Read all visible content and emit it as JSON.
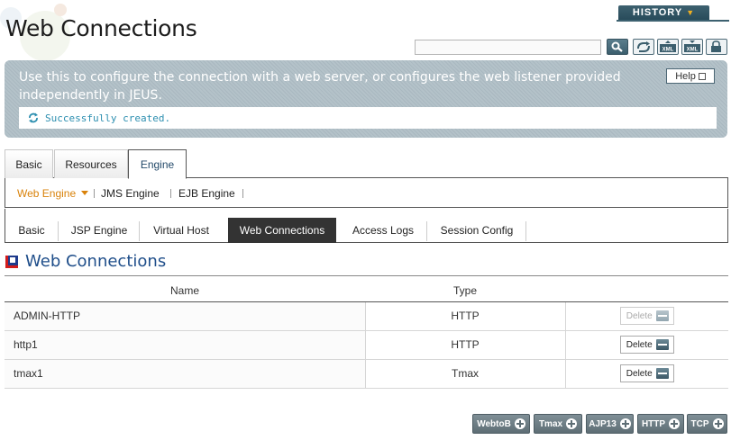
{
  "header": {
    "title": "Web Connections",
    "history_label": "HISTORY",
    "search_placeholder": ""
  },
  "toolbar": {
    "icons": [
      "search-icon",
      "refresh-icon",
      "xml-export-icon",
      "xml-import-icon",
      "lock-icon"
    ]
  },
  "info": {
    "description": "Use this to configure the connection with a web server, or configures the web listener provided independently in JEUS.",
    "help_label": "Help",
    "message": "Successfully created."
  },
  "main_tabs": [
    {
      "label": "Basic",
      "active": false
    },
    {
      "label": "Resources",
      "active": false
    },
    {
      "label": "Engine",
      "active": true
    }
  ],
  "engine_nav": [
    {
      "label": "Web Engine",
      "active": true
    },
    {
      "label": "JMS Engine",
      "active": false
    },
    {
      "label": "EJB Engine",
      "active": false
    }
  ],
  "web_tabs": [
    {
      "label": "Basic",
      "active": false
    },
    {
      "label": "JSP Engine",
      "active": false
    },
    {
      "label": "Virtual Host",
      "active": false
    },
    {
      "label": "Web Connections",
      "active": true
    },
    {
      "label": "Access Logs",
      "active": false
    },
    {
      "label": "Session Config",
      "active": false
    }
  ],
  "section": {
    "title": "Web Connections"
  },
  "table": {
    "columns": [
      "Name",
      "Type",
      ""
    ],
    "rows": [
      {
        "name": "ADMIN-HTTP",
        "type": "HTTP",
        "action": "Delete",
        "action_enabled": false
      },
      {
        "name": "http1",
        "type": "HTTP",
        "action": "Delete",
        "action_enabled": true
      },
      {
        "name": "tmax1",
        "type": "Tmax",
        "action": "Delete",
        "action_enabled": true
      }
    ]
  },
  "add_buttons": [
    "WebtoB",
    "Tmax",
    "AJP13",
    "HTTP",
    "TCP"
  ],
  "colors": {
    "accent": "#d9820a",
    "title_blue": "#1f4e8a",
    "message": "#2d8fb0",
    "active_tab": "#333333"
  }
}
